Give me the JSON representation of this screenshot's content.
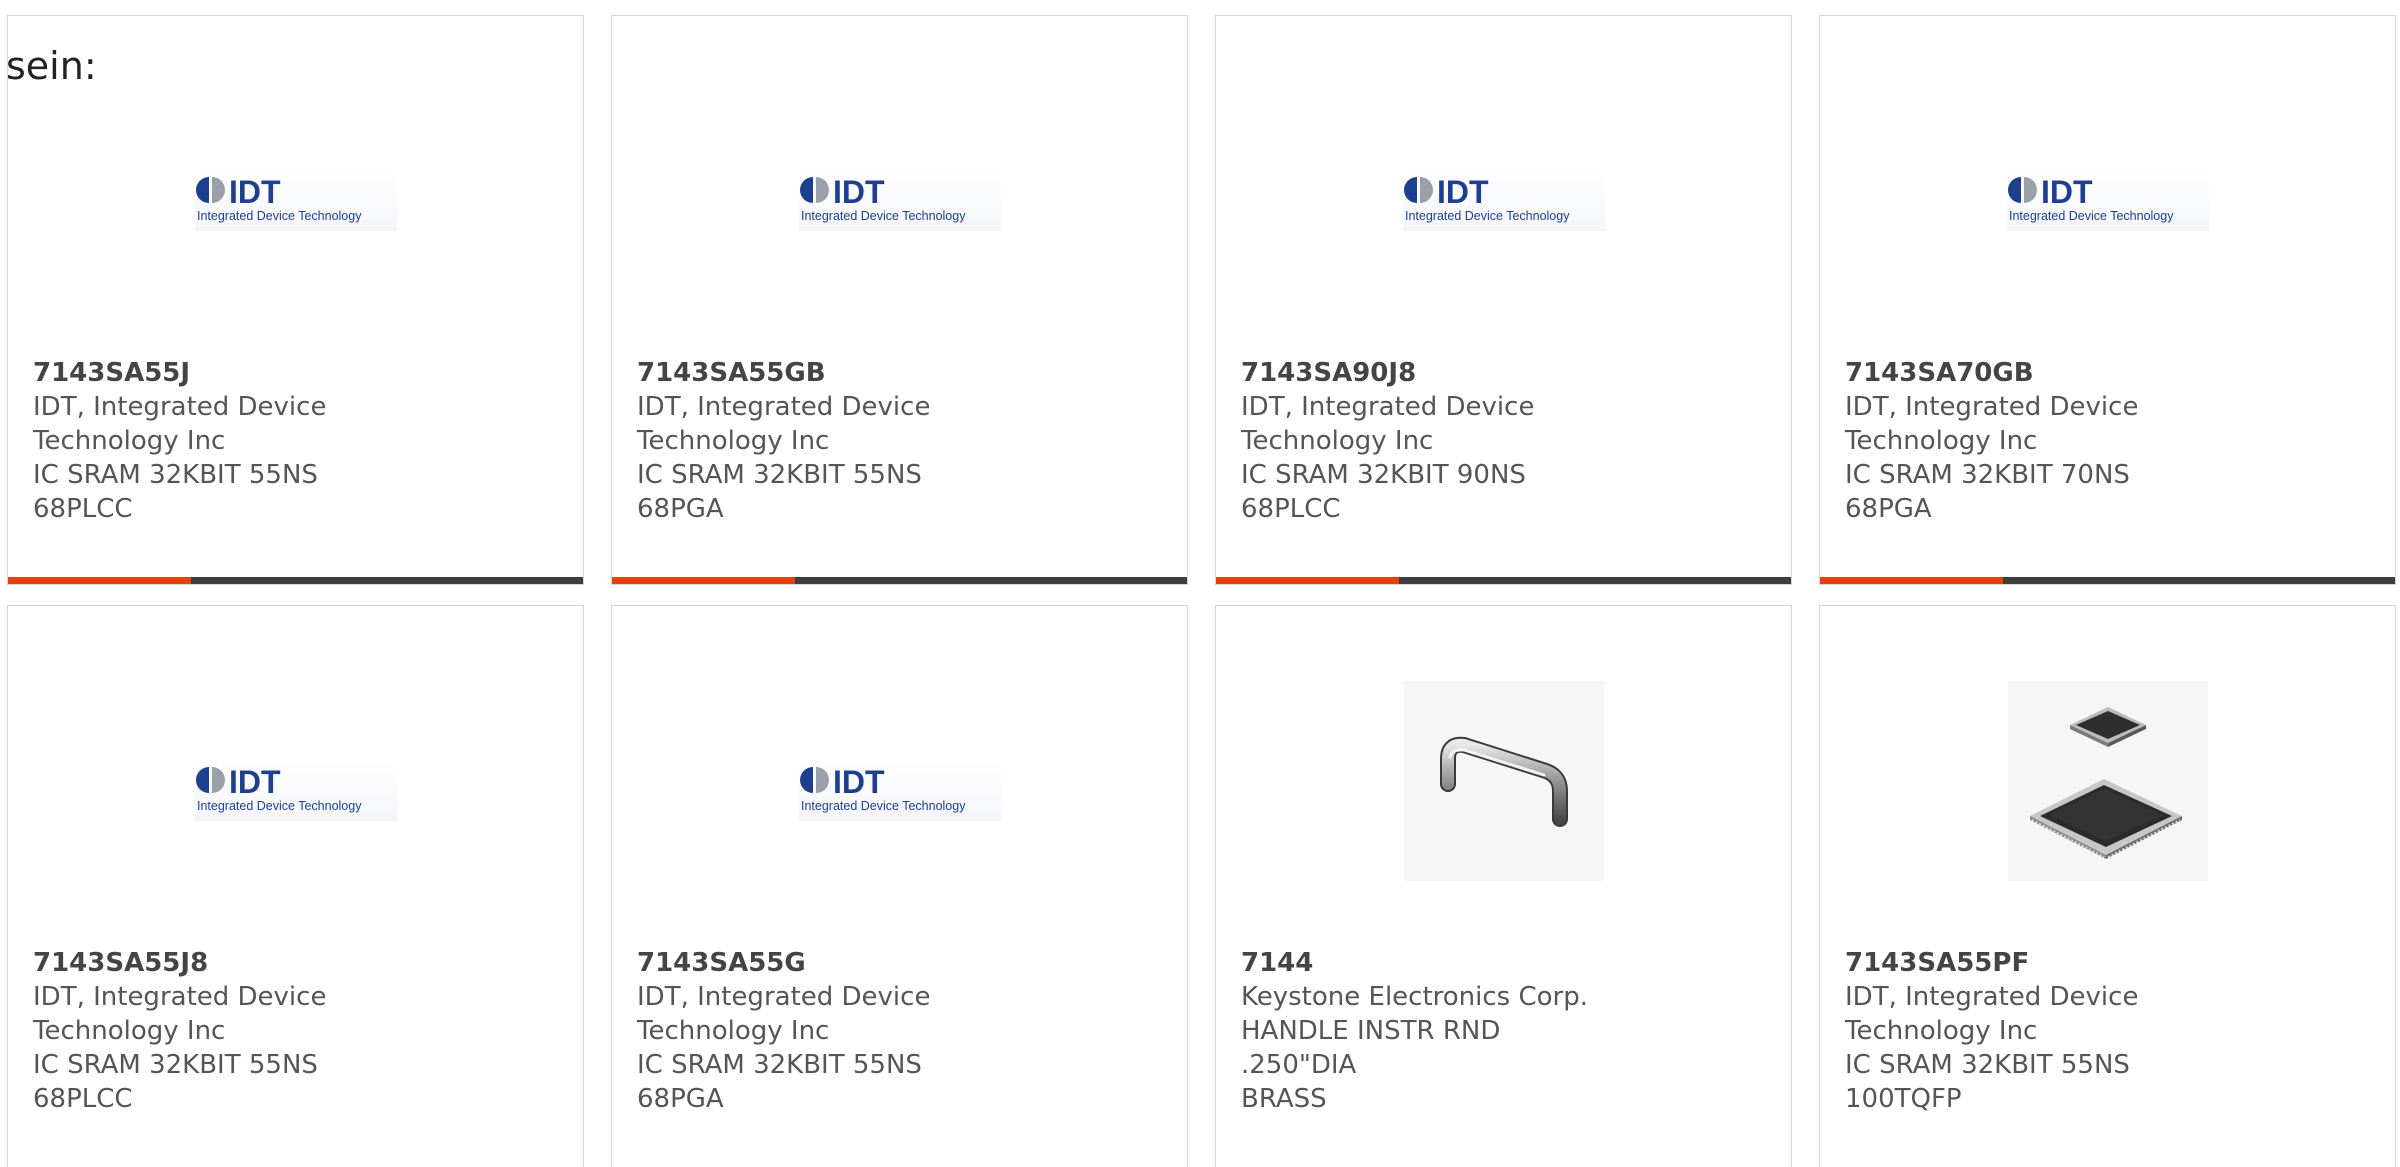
{
  "intro_text": "sein:",
  "accent_color": "#e8410f",
  "bar_color": "#3f3f3f",
  "logo": {
    "brand": "IDT",
    "tagline": "Integrated Device Technology",
    "brand_color": "#1e3f8f"
  },
  "products": [
    {
      "part_number": "7143SA55J",
      "manufacturer_line1": "IDT, Integrated Device",
      "manufacturer_line2": "Technology Inc",
      "description_line1": "IC SRAM 32KBIT 55NS 68PLCC",
      "description_line2": "",
      "image": "idt-logo"
    },
    {
      "part_number": "7143SA55GB",
      "manufacturer_line1": "IDT, Integrated Device",
      "manufacturer_line2": "Technology Inc",
      "description_line1": "IC SRAM 32KBIT 55NS 68PGA",
      "description_line2": "",
      "image": "idt-logo"
    },
    {
      "part_number": "7143SA90J8",
      "manufacturer_line1": "IDT, Integrated Device",
      "manufacturer_line2": "Technology Inc",
      "description_line1": "IC SRAM 32KBIT 90NS 68PLCC",
      "description_line2": "",
      "image": "idt-logo"
    },
    {
      "part_number": "7143SA70GB",
      "manufacturer_line1": "IDT, Integrated Device",
      "manufacturer_line2": "Technology Inc",
      "description_line1": "IC SRAM 32KBIT 70NS 68PGA",
      "description_line2": "",
      "image": "idt-logo"
    },
    {
      "part_number": "7143SA55J8",
      "manufacturer_line1": "IDT, Integrated Device",
      "manufacturer_line2": "Technology Inc",
      "description_line1": "IC SRAM 32KBIT 55NS 68PLCC",
      "description_line2": "",
      "image": "idt-logo"
    },
    {
      "part_number": "7143SA55G",
      "manufacturer_line1": "IDT, Integrated Device",
      "manufacturer_line2": "Technology Inc",
      "description_line1": "IC SRAM 32KBIT 55NS 68PGA",
      "description_line2": "",
      "image": "idt-logo"
    },
    {
      "part_number": "7144",
      "manufacturer_line1": "Keystone Electronics Corp.",
      "manufacturer_line2": "",
      "description_line1": "HANDLE INSTR RND .250\"DIA",
      "description_line2": "BRASS",
      "image": "handle-photo"
    },
    {
      "part_number": "7143SA55PF",
      "manufacturer_line1": "IDT, Integrated Device",
      "manufacturer_line2": "Technology Inc",
      "description_line1": "IC SRAM 32KBIT 55NS 100TQFP",
      "description_line2": "",
      "image": "chip-photo"
    }
  ]
}
